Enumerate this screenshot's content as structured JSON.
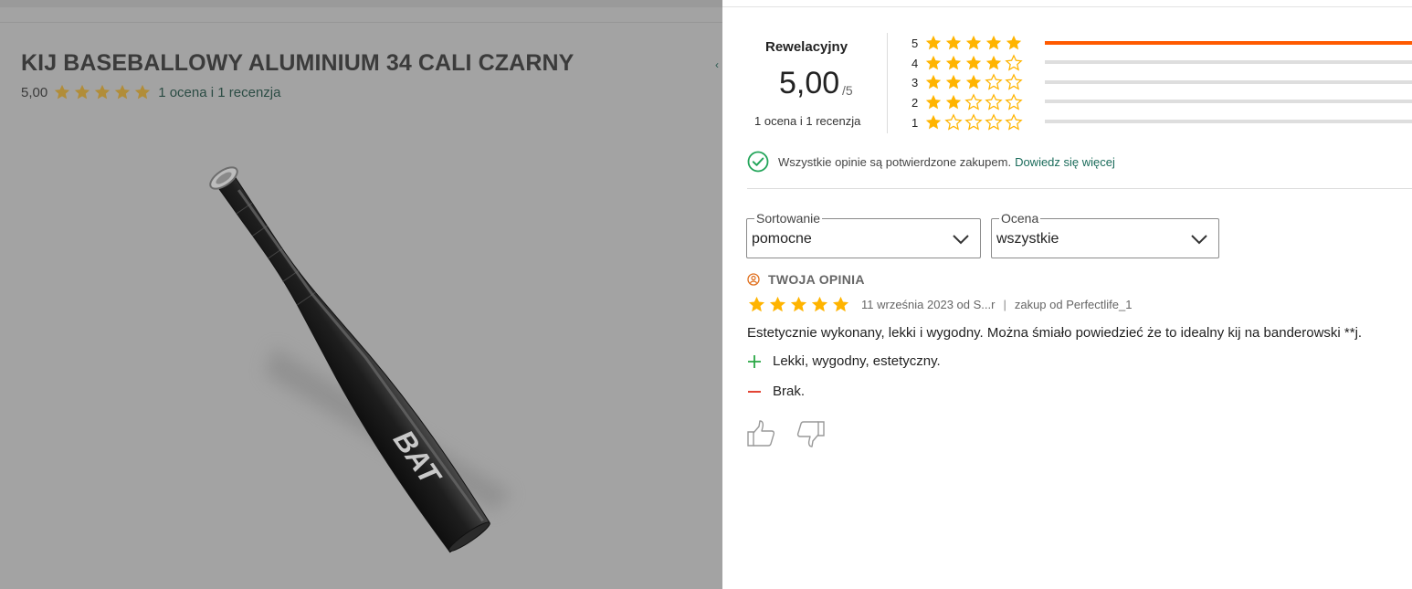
{
  "product": {
    "title": "KIJ BASEBALLOWY ALUMINIUM 34 CALI CZARNY",
    "rating_value": "5,00",
    "rating_stars": 5,
    "ratings_link": "1 ocena i 1 recenzja",
    "bat_print": "BAT"
  },
  "summary": {
    "label": "Rewelacyjny",
    "score": "5,00",
    "max": "/5",
    "count": "1 ocena i 1 recenzja"
  },
  "distribution": [
    {
      "stars": "5",
      "level": 5,
      "share": 1.0
    },
    {
      "stars": "4",
      "level": 4,
      "share": 0.0
    },
    {
      "stars": "3",
      "level": 3,
      "share": 0.0
    },
    {
      "stars": "2",
      "level": 2,
      "share": 0.0
    },
    {
      "stars": "1",
      "level": 1,
      "share": 0.0
    }
  ],
  "verified": {
    "text": "Wszystkie opinie są potwierdzone zakupem.",
    "link": "Dowiedz się więcej"
  },
  "filters": {
    "sort": {
      "label": "Sortowanie",
      "value": "pomocne"
    },
    "rating": {
      "label": "Ocena",
      "value": "wszystkie"
    }
  },
  "review": {
    "badge": "TWOJA OPINIA",
    "stars": 5,
    "date": "11 września 2023 od S...r",
    "separator": "|",
    "purchase": "zakup od Perfectlife_1",
    "text": "Estetycznie wykonany, lekki i wygodny. Można śmiało powiedzieć że to idealny kij na banderowski **j.",
    "pros": "Lekki, wygodny, estetyczny.",
    "cons": "Brak."
  },
  "colors": {
    "star": "#ffb400",
    "star_dimmed": "#b18d39",
    "accent": "#ff5a00",
    "link": "#1a6b5a",
    "verified": "#23a55a",
    "plus": "#2aa845",
    "minus": "#e0301e"
  },
  "icons": {
    "star": "star-icon",
    "verified": "check-circle-icon",
    "chevron": "chevron-down-icon",
    "badge": "user-icon",
    "plus": "plus-icon",
    "minus": "minus-icon",
    "like": "thumbs-up-icon",
    "dislike": "thumbs-down-icon"
  }
}
